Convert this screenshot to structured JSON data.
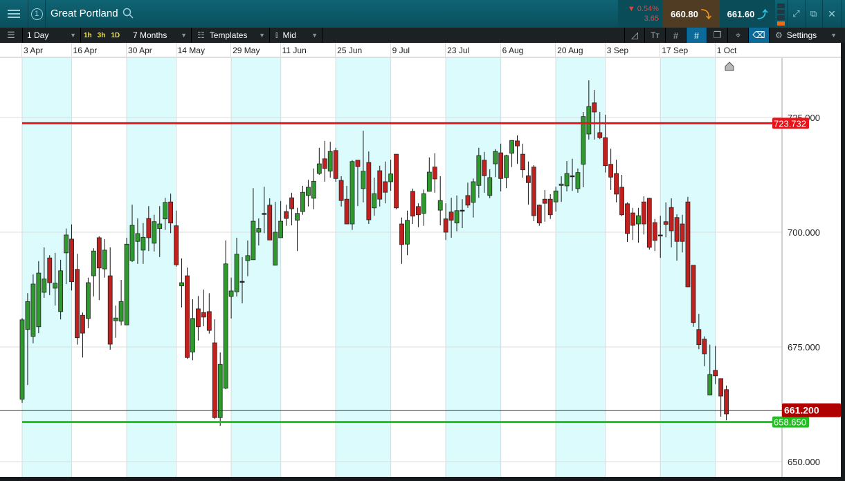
{
  "header": {
    "instrument_number": "1",
    "title": "Great Portland",
    "change_percent": "0.54%",
    "change_value": "3.65",
    "sell_price": "660.80",
    "buy_price": "661.60",
    "icons": [
      "menu-icon",
      "search-icon",
      "expand-icon",
      "popout-icon",
      "close-icon"
    ]
  },
  "toolbar": {
    "interval": "1 Day",
    "quick_intervals": [
      "1h",
      "3h",
      "1D"
    ],
    "range": "7 Months",
    "templates": "Templates",
    "price_type": "Mid",
    "settings": "Settings",
    "tools": [
      "trendline-icon",
      "text-icon",
      "grid-icon",
      "snap-icon",
      "layers-icon",
      "crosshair-icon",
      "tag-icon"
    ]
  },
  "colors": {
    "up": "#2e9a2e",
    "down": "#c0201e",
    "resistance": "#e8141a",
    "support": "#20c020",
    "current": "#b00000",
    "shade": "#dcfbfc"
  },
  "chart_data": {
    "type": "candlestick",
    "x_tick_labels": [
      "3 Apr",
      "16 Apr",
      "30 Apr",
      "14 May",
      "29 May",
      "11 Jun",
      "25 Jun",
      "9 Jul",
      "23 Jul",
      "6 Aug",
      "20 Aug",
      "3 Sep",
      "17 Sep",
      "1 Oct"
    ],
    "y_tick_labels": [
      "725.000",
      "700.000",
      "675.000",
      "650.000"
    ],
    "y_ticks": [
      725,
      700,
      675,
      650
    ],
    "grid": true,
    "horizontal_lines": [
      {
        "label": "723.732",
        "value": 723.732,
        "color": "#e8141a"
      },
      {
        "label": "658.650",
        "value": 658.65,
        "color": "#20c020"
      }
    ],
    "current_price": {
      "label": "661.200",
      "value": 661.2
    },
    "ohlc": [
      [
        663.6,
        681.3,
        662.8,
        680.9
      ],
      [
        678.8,
        686.7,
        666.7,
        684.9
      ],
      [
        677.3,
        690.8,
        675.8,
        688.7
      ],
      [
        679.4,
        693.7,
        678.0,
        691.1
      ],
      [
        686.9,
        696.7,
        685.7,
        689.8
      ],
      [
        694.4,
        695.0,
        686.3,
        689.0
      ],
      [
        687.8,
        695.5,
        684.0,
        688.9
      ],
      [
        682.7,
        694.0,
        681.0,
        691.6
      ],
      [
        695.5,
        700.8,
        688.7,
        699.4
      ],
      [
        698.5,
        701.7,
        687.3,
        689.2
      ],
      [
        691.9,
        695.3,
        675.5,
        677.0
      ],
      [
        681.9,
        682.5,
        672.7,
        678.0
      ],
      [
        681.2,
        690.1,
        679.1,
        689.0
      ],
      [
        690.5,
        696.5,
        686.0,
        695.9
      ],
      [
        698.8,
        699.1,
        685.2,
        692.2
      ],
      [
        692.0,
        698.5,
        690.1,
        696.1
      ],
      [
        690.5,
        696.7,
        674.4,
        675.6
      ],
      [
        680.7,
        684.0,
        677.0,
        681.3
      ],
      [
        680.6,
        689.6,
        679.7,
        684.9
      ],
      [
        679.8,
        698.8,
        679.8,
        697.4
      ],
      [
        693.8,
        706.0,
        693.5,
        701.5
      ],
      [
        698.0,
        703.0,
        693.1,
        699.7
      ],
      [
        696.1,
        702.0,
        693.1,
        698.9
      ],
      [
        703.0,
        705.7,
        695.9,
        698.8
      ],
      [
        697.6,
        703.8,
        695.8,
        702.3
      ],
      [
        700.8,
        705.7,
        694.6,
        701.8
      ],
      [
        702.9,
        707.5,
        700.5,
        706.5
      ],
      [
        706.6,
        708.4,
        699.8,
        702.0
      ],
      [
        701.4,
        704.7,
        692.5,
        692.9
      ],
      [
        688.3,
        694.3,
        683.6,
        689.0
      ],
      [
        690.5,
        692.3,
        672.4,
        672.7
      ],
      [
        673.9,
        685.4,
        672.1,
        681.2
      ],
      [
        683.3,
        686.1,
        676.4,
        679.4
      ],
      [
        682.5,
        687.5,
        679.5,
        681.5
      ],
      [
        682.7,
        686.7,
        677.9,
        678.6
      ],
      [
        675.9,
        681.0,
        659.3,
        659.6
      ],
      [
        659.6,
        673.8,
        657.8,
        671.2
      ],
      [
        666.0,
        698.2,
        665.8,
        693.1
      ],
      [
        686.0,
        690.1,
        681.2,
        687.2
      ],
      [
        687.0,
        698.8,
        686.0,
        695.2
      ],
      [
        689.3,
        694.6,
        684.5,
        689.3
      ],
      [
        693.8,
        698.2,
        690.4,
        694.9
      ],
      [
        694.0,
        709.6,
        694.0,
        702.4
      ],
      [
        700.0,
        703.0,
        697.1,
        700.8
      ],
      [
        704.1,
        709.9,
        699.8,
        704.1
      ],
      [
        705.9,
        707.4,
        698.3,
        698.3
      ],
      [
        692.8,
        706.6,
        692.8,
        700.0
      ],
      [
        698.8,
        706.8,
        698.8,
        702.4
      ],
      [
        704.5,
        706.0,
        701.4,
        703.0
      ],
      [
        707.5,
        708.6,
        701.5,
        705.1
      ],
      [
        702.6,
        705.3,
        695.9,
        704.1
      ],
      [
        704.5,
        710.1,
        703.8,
        708.7
      ],
      [
        708.0,
        711.4,
        705.6,
        709.8
      ],
      [
        707.4,
        713.9,
        705.0,
        711.1
      ],
      [
        712.8,
        718.4,
        712.5,
        714.9
      ],
      [
        716.0,
        719.9,
        711.0,
        713.9
      ],
      [
        713.3,
        719.7,
        711.9,
        717.6
      ],
      [
        717.8,
        718.4,
        711.0,
        711.7
      ],
      [
        711.3,
        712.2,
        705.6,
        706.9
      ],
      [
        707.2,
        710.1,
        701.8,
        701.8
      ],
      [
        701.8,
        715.7,
        700.5,
        715.4
      ],
      [
        715.7,
        715.7,
        705.7,
        714.3
      ],
      [
        709.5,
        722.1,
        706.5,
        713.3
      ],
      [
        715.2,
        717.6,
        701.8,
        702.7
      ],
      [
        705.3,
        711.9,
        703.6,
        708.4
      ],
      [
        713.4,
        714.5,
        705.6,
        707.2
      ],
      [
        711.0,
        715.4,
        706.3,
        708.7
      ],
      [
        711.0,
        715.8,
        709.0,
        712.7
      ],
      [
        717.0,
        717.0,
        705.0,
        705.3
      ],
      [
        701.8,
        703.2,
        693.1,
        697.3
      ],
      [
        697.4,
        704.7,
        695.0,
        702.6
      ],
      [
        708.9,
        709.5,
        701.8,
        703.5
      ],
      [
        705.6,
        706.3,
        701.1,
        703.8
      ],
      [
        704.1,
        709.3,
        701.4,
        708.4
      ],
      [
        708.9,
        716.3,
        708.9,
        713.1
      ],
      [
        714.2,
        717.2,
        708.6,
        711.6
      ],
      [
        704.8,
        712.2,
        701.5,
        706.9
      ],
      [
        702.9,
        706.3,
        698.3,
        700.0
      ],
      [
        704.4,
        707.5,
        698.8,
        702.6
      ],
      [
        702.0,
        708.0,
        700.2,
        704.7
      ],
      [
        704.8,
        707.2,
        700.9,
        704.8
      ],
      [
        708.0,
        710.8,
        705.3,
        705.9
      ],
      [
        706.5,
        711.7,
        703.2,
        711.0
      ],
      [
        710.2,
        718.4,
        707.5,
        716.7
      ],
      [
        715.7,
        717.5,
        708.6,
        712.3
      ],
      [
        708.0,
        713.7,
        707.4,
        711.9
      ],
      [
        714.9,
        718.1,
        712.0,
        717.6
      ],
      [
        717.3,
        719.3,
        708.9,
        711.7
      ],
      [
        711.9,
        716.9,
        709.6,
        716.7
      ],
      [
        717.2,
        720.0,
        714.2,
        720.0
      ],
      [
        719.9,
        721.1,
        714.9,
        718.8
      ],
      [
        717.0,
        719.3,
        711.9,
        713.6
      ],
      [
        712.3,
        715.4,
        706.0,
        710.8
      ],
      [
        714.2,
        714.6,
        702.4,
        703.6
      ],
      [
        705.9,
        706.0,
        701.4,
        702.0
      ],
      [
        707.2,
        709.2,
        702.3,
        706.3
      ],
      [
        707.2,
        708.3,
        702.9,
        703.8
      ],
      [
        706.6,
        709.9,
        704.5,
        709.0
      ],
      [
        710.2,
        712.2,
        706.6,
        710.5
      ],
      [
        710.1,
        715.5,
        708.9,
        712.8
      ],
      [
        712.3,
        716.0,
        709.0,
        712.3
      ],
      [
        709.5,
        713.9,
        708.6,
        713.0
      ],
      [
        714.8,
        726.2,
        709.8,
        725.2
      ],
      [
        721.4,
        733.1,
        720.2,
        727.4
      ],
      [
        728.2,
        731.0,
        720.2,
        726.2
      ],
      [
        721.7,
        726.2,
        720.3,
        720.6
      ],
      [
        720.6,
        725.6,
        713.0,
        714.5
      ],
      [
        714.8,
        718.2,
        709.2,
        712.0
      ],
      [
        712.8,
        715.8,
        706.5,
        708.3
      ],
      [
        709.8,
        712.5,
        703.5,
        703.8
      ],
      [
        706.2,
        706.5,
        697.9,
        699.7
      ],
      [
        704.2,
        705.3,
        698.3,
        701.5
      ],
      [
        701.8,
        705.3,
        697.7,
        703.6
      ],
      [
        706.6,
        707.8,
        699.5,
        701.8
      ],
      [
        707.4,
        707.5,
        696.2,
        696.7
      ],
      [
        702.1,
        702.9,
        695.9,
        698.2
      ],
      [
        699.4,
        703.6,
        694.4,
        699.4
      ],
      [
        702.3,
        706.5,
        698.9,
        701.7
      ],
      [
        705.4,
        707.4,
        696.7,
        700.3
      ],
      [
        703.2,
        703.9,
        693.8,
        698.0
      ],
      [
        701.8,
        703.8,
        695.6,
        698.0
      ],
      [
        706.6,
        707.7,
        688.0,
        688.1
      ],
      [
        692.8,
        692.8,
        679.4,
        680.3
      ],
      [
        678.8,
        682.2,
        674.5,
        675.5
      ],
      [
        676.7,
        677.3,
        670.8,
        673.5
      ],
      [
        664.5,
        675.5,
        664.5,
        669.0
      ],
      [
        669.9,
        675.2,
        666.9,
        668.7
      ],
      [
        668.1,
        668.1,
        659.8,
        664.3
      ],
      [
        665.7,
        666.6,
        659.0,
        660.4
      ]
    ]
  }
}
